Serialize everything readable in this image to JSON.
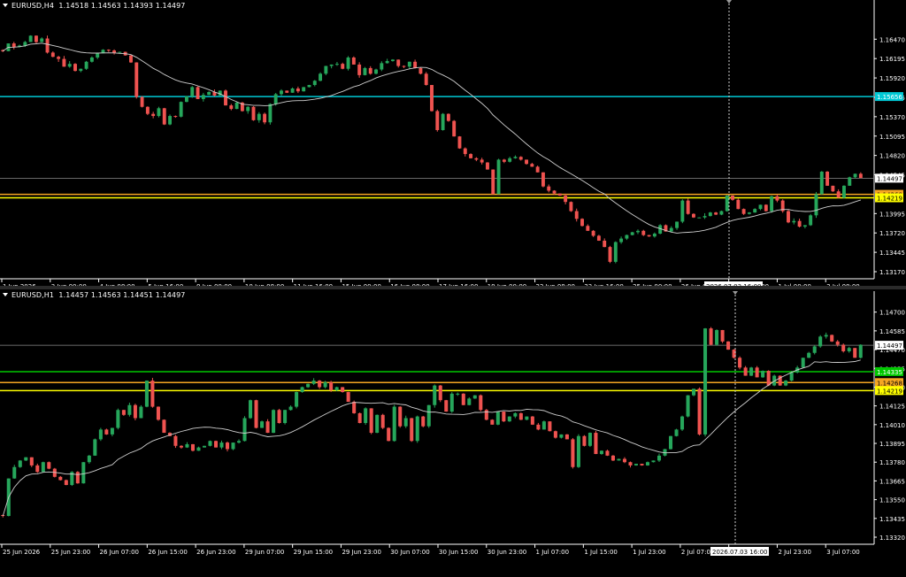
{
  "chart_data": [
    {
      "type": "candlestick",
      "symbol_label": "EURUSD,H4",
      "ohlc_label": "1.14518 1.14563 1.14393 1.14497",
      "y_ticks": [
        "1.16470",
        "1.16195",
        "1.15920",
        "1.15645",
        "1.15370",
        "1.15095",
        "1.14820",
        "1.14545",
        "1.13995",
        "1.13720",
        "1.13445",
        "1.13170"
      ],
      "ylim": [
        1.1317,
        1.1675
      ],
      "x_ticks": [
        "1 Jun 2026",
        "3 Jun 00:00",
        "4 Jun 08:00",
        "5 Jun 16:00",
        "9 Jun 00:00",
        "10 Jun 08:00",
        "11 Jun 16:00",
        "15 Jun 00:00",
        "16 Jun 08:00",
        "17 Jun 16:00",
        "19 Jun 00:00",
        "22 Jun 08:00",
        "23 Jun 16:00",
        "25 Jun 00:00",
        "26 Jun 08:00",
        "29 Jun 16:00",
        "1 Jul 00:00",
        "2 Jul 08:00"
      ],
      "cursor_time": "2026.07.03 16:00",
      "price_labels": [
        {
          "text": "1.15656",
          "value": 1.15656,
          "color": "#00c8d4",
          "text_color": "#ffffff"
        },
        {
          "text": "1.14497",
          "value": 1.14497,
          "color": "#ffffff",
          "text_color": "#000000"
        },
        {
          "text": "1.14268",
          "value": 1.14268,
          "color": "#f5a623",
          "text_color": "#000000"
        },
        {
          "text": "1.14219",
          "value": 1.14219,
          "color": "#ffff00",
          "text_color": "#000000"
        }
      ],
      "h_lines": [
        {
          "value": 1.15656,
          "color": "#00c8d4",
          "width": 1.5
        },
        {
          "value": 1.14497,
          "color": "#8c8c8c",
          "width": 0.8
        },
        {
          "value": 1.14268,
          "color": "#f5a623",
          "width": 1.5
        },
        {
          "value": 1.14219,
          "color": "#ffff00",
          "width": 1.5
        }
      ],
      "closes": [
        1.163,
        1.1641,
        1.1636,
        1.1638,
        1.1643,
        1.1652,
        1.1643,
        1.1648,
        1.1628,
        1.1622,
        1.1619,
        1.1608,
        1.1612,
        1.1602,
        1.1605,
        1.1615,
        1.1621,
        1.1627,
        1.1632,
        1.1631,
        1.1628,
        1.1629,
        1.1624,
        1.1614,
        1.1565,
        1.1551,
        1.1541,
        1.1538,
        1.1549,
        1.1526,
        1.1538,
        1.1537,
        1.1558,
        1.1566,
        1.1579,
        1.1562,
        1.1568,
        1.1572,
        1.1567,
        1.1574,
        1.1553,
        1.1548,
        1.1557,
        1.1545,
        1.1551,
        1.1532,
        1.1541,
        1.1529,
        1.1555,
        1.1569,
        1.1574,
        1.1571,
        1.1577,
        1.1573,
        1.1579,
        1.1582,
        1.1588,
        1.1598,
        1.1609,
        1.1611,
        1.1612,
        1.1605,
        1.1621,
        1.1611,
        1.1596,
        1.1606,
        1.1598,
        1.1604,
        1.1613,
        1.1616,
        1.1618,
        1.1609,
        1.1608,
        1.1615,
        1.1606,
        1.1598,
        1.1582,
        1.1545,
        1.1518,
        1.1541,
        1.1531,
        1.1509,
        1.1492,
        1.1484,
        1.1478,
        1.1476,
        1.1472,
        1.1462,
        1.1427,
        1.1476,
        1.1473,
        1.1478,
        1.148,
        1.1476,
        1.147,
        1.1466,
        1.1458,
        1.1438,
        1.1432,
        1.1428,
        1.1425,
        1.1416,
        1.1403,
        1.1392,
        1.1382,
        1.1375,
        1.1368,
        1.1361,
        1.1352,
        1.1331,
        1.1359,
        1.1364,
        1.1369,
        1.1373,
        1.1375,
        1.1369,
        1.1367,
        1.1371,
        1.1383,
        1.1374,
        1.1379,
        1.1388,
        1.1418,
        1.1399,
        1.1394,
        1.1394,
        1.1396,
        1.1401,
        1.1398,
        1.1403,
        1.1425,
        1.1419,
        1.1406,
        1.1399,
        1.1401,
        1.1406,
        1.1412,
        1.1403,
        1.1424,
        1.1418,
        1.1403,
        1.1387,
        1.1389,
        1.1381,
        1.1383,
        1.1397,
        1.1427,
        1.1459,
        1.1439,
        1.1431,
        1.1422,
        1.1439,
        1.1451,
        1.1456,
        1.145
      ]
    },
    {
      "type": "candlestick",
      "symbol_label": "EURUSD,H1",
      "ohlc_label": "1.14457 1.14563 1.14451 1.14497",
      "y_ticks": [
        "1.14700",
        "1.14585",
        "1.14470",
        "1.14355",
        "1.14240",
        "1.14125",
        "1.14010",
        "1.13895",
        "1.13780",
        "1.13665",
        "1.13550",
        "1.13435",
        "1.13320"
      ],
      "ylim": [
        1.1332,
        1.1472
      ],
      "x_ticks": [
        "25 Jun 2026",
        "25 Jun 23:00",
        "26 Jun 07:00",
        "26 Jun 15:00",
        "26 Jun 23:00",
        "29 Jun 07:00",
        "29 Jun 15:00",
        "29 Jun 23:00",
        "30 Jun 07:00",
        "30 Jun 15:00",
        "30 Jun 23:00",
        "1 Jul 07:00",
        "1 Jul 15:00",
        "1 Jul 23:00",
        "2 Jul 07:00",
        "2 Jul 15:00",
        "2 Jul 23:00",
        "3 Jul 07:00"
      ],
      "cursor_time": "2026.07.03 16:00",
      "price_labels": [
        {
          "text": "1.14497",
          "value": 1.14497,
          "color": "#ffffff",
          "text_color": "#000000"
        },
        {
          "text": "1.14335",
          "value": 1.14335,
          "color": "#00c800",
          "text_color": "#ffffff"
        },
        {
          "text": "1.14268",
          "value": 1.14268,
          "color": "#f5a623",
          "text_color": "#000000"
        },
        {
          "text": "1.14219",
          "value": 1.14219,
          "color": "#ffff00",
          "text_color": "#000000"
        }
      ],
      "h_lines": [
        {
          "value": 1.14497,
          "color": "#8c8c8c",
          "width": 0.8
        },
        {
          "value": 1.14335,
          "color": "#00c800",
          "width": 1.5
        },
        {
          "value": 1.14268,
          "color": "#f5a623",
          "width": 1.5
        },
        {
          "value": 1.14219,
          "color": "#ffff00",
          "width": 1.5
        }
      ],
      "closes": [
        1.1345,
        1.1368,
        1.1375,
        1.1379,
        1.1381,
        1.1376,
        1.1372,
        1.1378,
        1.1374,
        1.1369,
        1.1367,
        1.1364,
        1.1372,
        1.1365,
        1.1378,
        1.1382,
        1.1392,
        1.1398,
        1.1395,
        1.1399,
        1.141,
        1.1407,
        1.1413,
        1.1405,
        1.1412,
        1.1428,
        1.1412,
        1.1404,
        1.1396,
        1.1394,
        1.1388,
        1.1387,
        1.1389,
        1.1385,
        1.1387,
        1.1388,
        1.1391,
        1.1387,
        1.139,
        1.1386,
        1.139,
        1.1391,
        1.1405,
        1.1416,
        1.1399,
        1.1403,
        1.1396,
        1.141,
        1.1402,
        1.141,
        1.1412,
        1.1421,
        1.1424,
        1.1426,
        1.1428,
        1.1424,
        1.1427,
        1.1422,
        1.1424,
        1.1421,
        1.1415,
        1.1408,
        1.1402,
        1.1411,
        1.1396,
        1.1407,
        1.1399,
        1.1391,
        1.1412,
        1.14,
        1.1405,
        1.1391,
        1.1406,
        1.14,
        1.1413,
        1.1425,
        1.1416,
        1.1409,
        1.142,
        1.142,
        1.1413,
        1.1417,
        1.1419,
        1.141,
        1.1404,
        1.1401,
        1.1409,
        1.1403,
        1.1406,
        1.1408,
        1.1404,
        1.1406,
        1.1401,
        1.1398,
        1.1403,
        1.1397,
        1.1393,
        1.1395,
        1.1392,
        1.1375,
        1.1394,
        1.1388,
        1.1396,
        1.1383,
        1.1385,
        1.1382,
        1.1379,
        1.138,
        1.1378,
        1.1376,
        1.1377,
        1.1376,
        1.1378,
        1.1379,
        1.1382,
        1.1386,
        1.1394,
        1.1398,
        1.1406,
        1.1419,
        1.1423,
        1.1395,
        1.146,
        1.145,
        1.1459,
        1.1452,
        1.1447,
        1.1442,
        1.1436,
        1.1431,
        1.1436,
        1.143,
        1.1434,
        1.1425,
        1.1431,
        1.1425,
        1.1428,
        1.1433,
        1.1436,
        1.1442,
        1.1445,
        1.1449,
        1.1455,
        1.1456,
        1.1452,
        1.145,
        1.1446,
        1.1448,
        1.1442,
        1.145
      ]
    }
  ]
}
